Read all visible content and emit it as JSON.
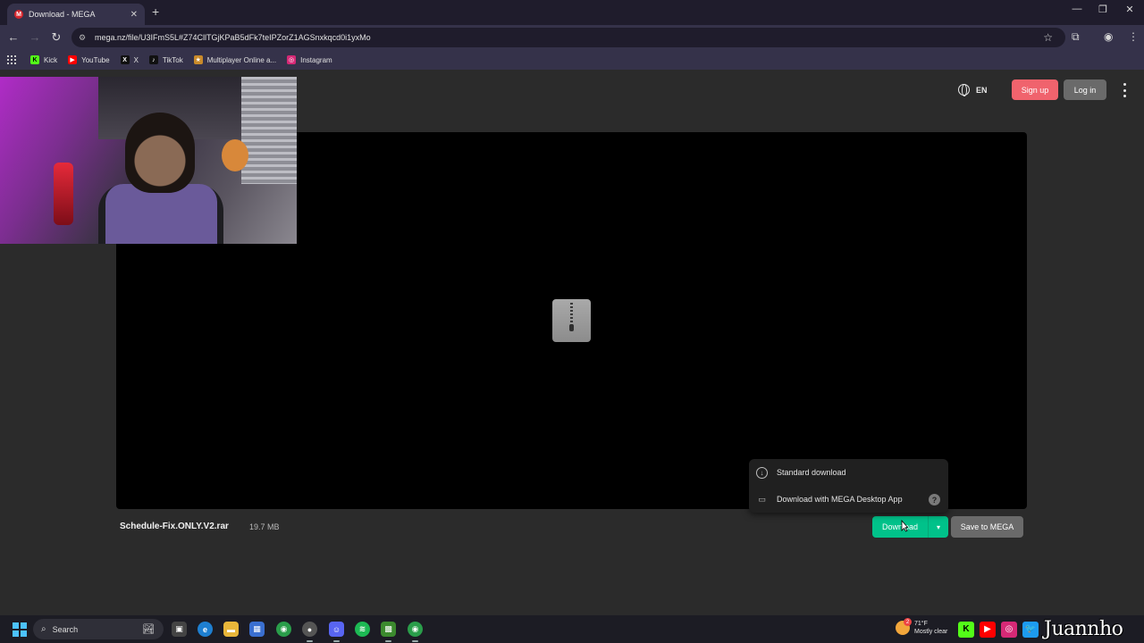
{
  "browser": {
    "tab_title": "Download - MEGA",
    "tab_favicon": "M",
    "new_tab": "+",
    "url": "mega.nz/file/U3IFmS5L#Z74CllTGjKPaB5dFk7teIPZorZ1AGSnxkqcd0i1yxMo",
    "bookmarks": [
      {
        "label": "Kick",
        "icon": "kick-icon",
        "color": "#53fc18",
        "glyph": "K"
      },
      {
        "label": "YouTube",
        "icon": "youtube-icon",
        "color": "#ff0000",
        "glyph": "▶"
      },
      {
        "label": "X",
        "icon": "x-icon",
        "color": "#111111",
        "glyph": "X"
      },
      {
        "label": "TikTok",
        "icon": "tiktok-icon",
        "color": "#111111",
        "glyph": "♪"
      },
      {
        "label": "Multiplayer Online a...",
        "icon": "multiplayer-icon",
        "color": "#c98a2a",
        "glyph": "★"
      },
      {
        "label": "Instagram",
        "icon": "instagram-icon",
        "color": "#d62976",
        "glyph": "◎"
      }
    ]
  },
  "header": {
    "language": "EN",
    "signup_label": "Sign up",
    "login_label": "Log in"
  },
  "file": {
    "name": "Schedule-Fix.ONLY.V2.rar",
    "size": "19.7 MB"
  },
  "actions": {
    "download_label": "Download",
    "save_label": "Save to MEGA"
  },
  "download_menu": {
    "items": [
      {
        "label": "Standard download",
        "icon": "download-icon"
      },
      {
        "label": "Download with MEGA Desktop App",
        "icon": "laptop-icon"
      }
    ],
    "help": "?"
  },
  "taskbar": {
    "search_label": "Search",
    "weather_temp": "71°F",
    "weather_desc": "Mostly clear",
    "weather_badge": "2",
    "handle": "Juannho"
  },
  "colors": {
    "accent_download": "#00c28a",
    "signup": "#f0636d",
    "login": "#6a6a6a"
  }
}
